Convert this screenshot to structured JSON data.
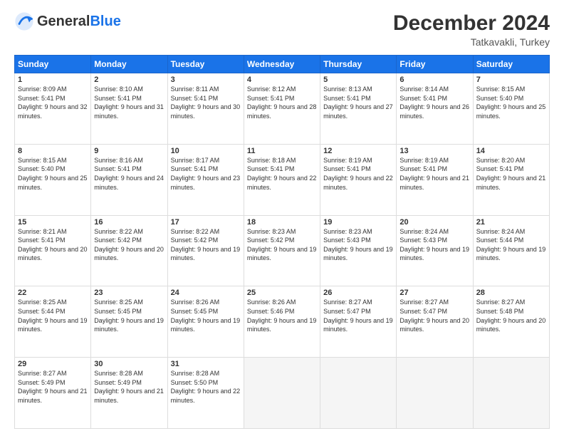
{
  "logo": {
    "general": "General",
    "blue": "Blue"
  },
  "title": "December 2024",
  "subtitle": "Tatkavakli, Turkey",
  "weekdays": [
    "Sunday",
    "Monday",
    "Tuesday",
    "Wednesday",
    "Thursday",
    "Friday",
    "Saturday"
  ],
  "weeks": [
    [
      {
        "day": "1",
        "sunrise": "8:09 AM",
        "sunset": "5:41 PM",
        "daylight": "9 hours and 32 minutes."
      },
      {
        "day": "2",
        "sunrise": "8:10 AM",
        "sunset": "5:41 PM",
        "daylight": "9 hours and 31 minutes."
      },
      {
        "day": "3",
        "sunrise": "8:11 AM",
        "sunset": "5:41 PM",
        "daylight": "9 hours and 30 minutes."
      },
      {
        "day": "4",
        "sunrise": "8:12 AM",
        "sunset": "5:41 PM",
        "daylight": "9 hours and 28 minutes."
      },
      {
        "day": "5",
        "sunrise": "8:13 AM",
        "sunset": "5:41 PM",
        "daylight": "9 hours and 27 minutes."
      },
      {
        "day": "6",
        "sunrise": "8:14 AM",
        "sunset": "5:41 PM",
        "daylight": "9 hours and 26 minutes."
      },
      {
        "day": "7",
        "sunrise": "8:15 AM",
        "sunset": "5:40 PM",
        "daylight": "9 hours and 25 minutes."
      }
    ],
    [
      {
        "day": "8",
        "sunrise": "8:15 AM",
        "sunset": "5:40 PM",
        "daylight": "9 hours and 25 minutes."
      },
      {
        "day": "9",
        "sunrise": "8:16 AM",
        "sunset": "5:41 PM",
        "daylight": "9 hours and 24 minutes."
      },
      {
        "day": "10",
        "sunrise": "8:17 AM",
        "sunset": "5:41 PM",
        "daylight": "9 hours and 23 minutes."
      },
      {
        "day": "11",
        "sunrise": "8:18 AM",
        "sunset": "5:41 PM",
        "daylight": "9 hours and 22 minutes."
      },
      {
        "day": "12",
        "sunrise": "8:19 AM",
        "sunset": "5:41 PM",
        "daylight": "9 hours and 22 minutes."
      },
      {
        "day": "13",
        "sunrise": "8:19 AM",
        "sunset": "5:41 PM",
        "daylight": "9 hours and 21 minutes."
      },
      {
        "day": "14",
        "sunrise": "8:20 AM",
        "sunset": "5:41 PM",
        "daylight": "9 hours and 21 minutes."
      }
    ],
    [
      {
        "day": "15",
        "sunrise": "8:21 AM",
        "sunset": "5:41 PM",
        "daylight": "9 hours and 20 minutes."
      },
      {
        "day": "16",
        "sunrise": "8:22 AM",
        "sunset": "5:42 PM",
        "daylight": "9 hours and 20 minutes."
      },
      {
        "day": "17",
        "sunrise": "8:22 AM",
        "sunset": "5:42 PM",
        "daylight": "9 hours and 19 minutes."
      },
      {
        "day": "18",
        "sunrise": "8:23 AM",
        "sunset": "5:42 PM",
        "daylight": "9 hours and 19 minutes."
      },
      {
        "day": "19",
        "sunrise": "8:23 AM",
        "sunset": "5:43 PM",
        "daylight": "9 hours and 19 minutes."
      },
      {
        "day": "20",
        "sunrise": "8:24 AM",
        "sunset": "5:43 PM",
        "daylight": "9 hours and 19 minutes."
      },
      {
        "day": "21",
        "sunrise": "8:24 AM",
        "sunset": "5:44 PM",
        "daylight": "9 hours and 19 minutes."
      }
    ],
    [
      {
        "day": "22",
        "sunrise": "8:25 AM",
        "sunset": "5:44 PM",
        "daylight": "9 hours and 19 minutes."
      },
      {
        "day": "23",
        "sunrise": "8:25 AM",
        "sunset": "5:45 PM",
        "daylight": "9 hours and 19 minutes."
      },
      {
        "day": "24",
        "sunrise": "8:26 AM",
        "sunset": "5:45 PM",
        "daylight": "9 hours and 19 minutes."
      },
      {
        "day": "25",
        "sunrise": "8:26 AM",
        "sunset": "5:46 PM",
        "daylight": "9 hours and 19 minutes."
      },
      {
        "day": "26",
        "sunrise": "8:27 AM",
        "sunset": "5:47 PM",
        "daylight": "9 hours and 19 minutes."
      },
      {
        "day": "27",
        "sunrise": "8:27 AM",
        "sunset": "5:47 PM",
        "daylight": "9 hours and 20 minutes."
      },
      {
        "day": "28",
        "sunrise": "8:27 AM",
        "sunset": "5:48 PM",
        "daylight": "9 hours and 20 minutes."
      }
    ],
    [
      {
        "day": "29",
        "sunrise": "8:27 AM",
        "sunset": "5:49 PM",
        "daylight": "9 hours and 21 minutes."
      },
      {
        "day": "30",
        "sunrise": "8:28 AM",
        "sunset": "5:49 PM",
        "daylight": "9 hours and 21 minutes."
      },
      {
        "day": "31",
        "sunrise": "8:28 AM",
        "sunset": "5:50 PM",
        "daylight": "9 hours and 22 minutes."
      },
      null,
      null,
      null,
      null
    ]
  ]
}
